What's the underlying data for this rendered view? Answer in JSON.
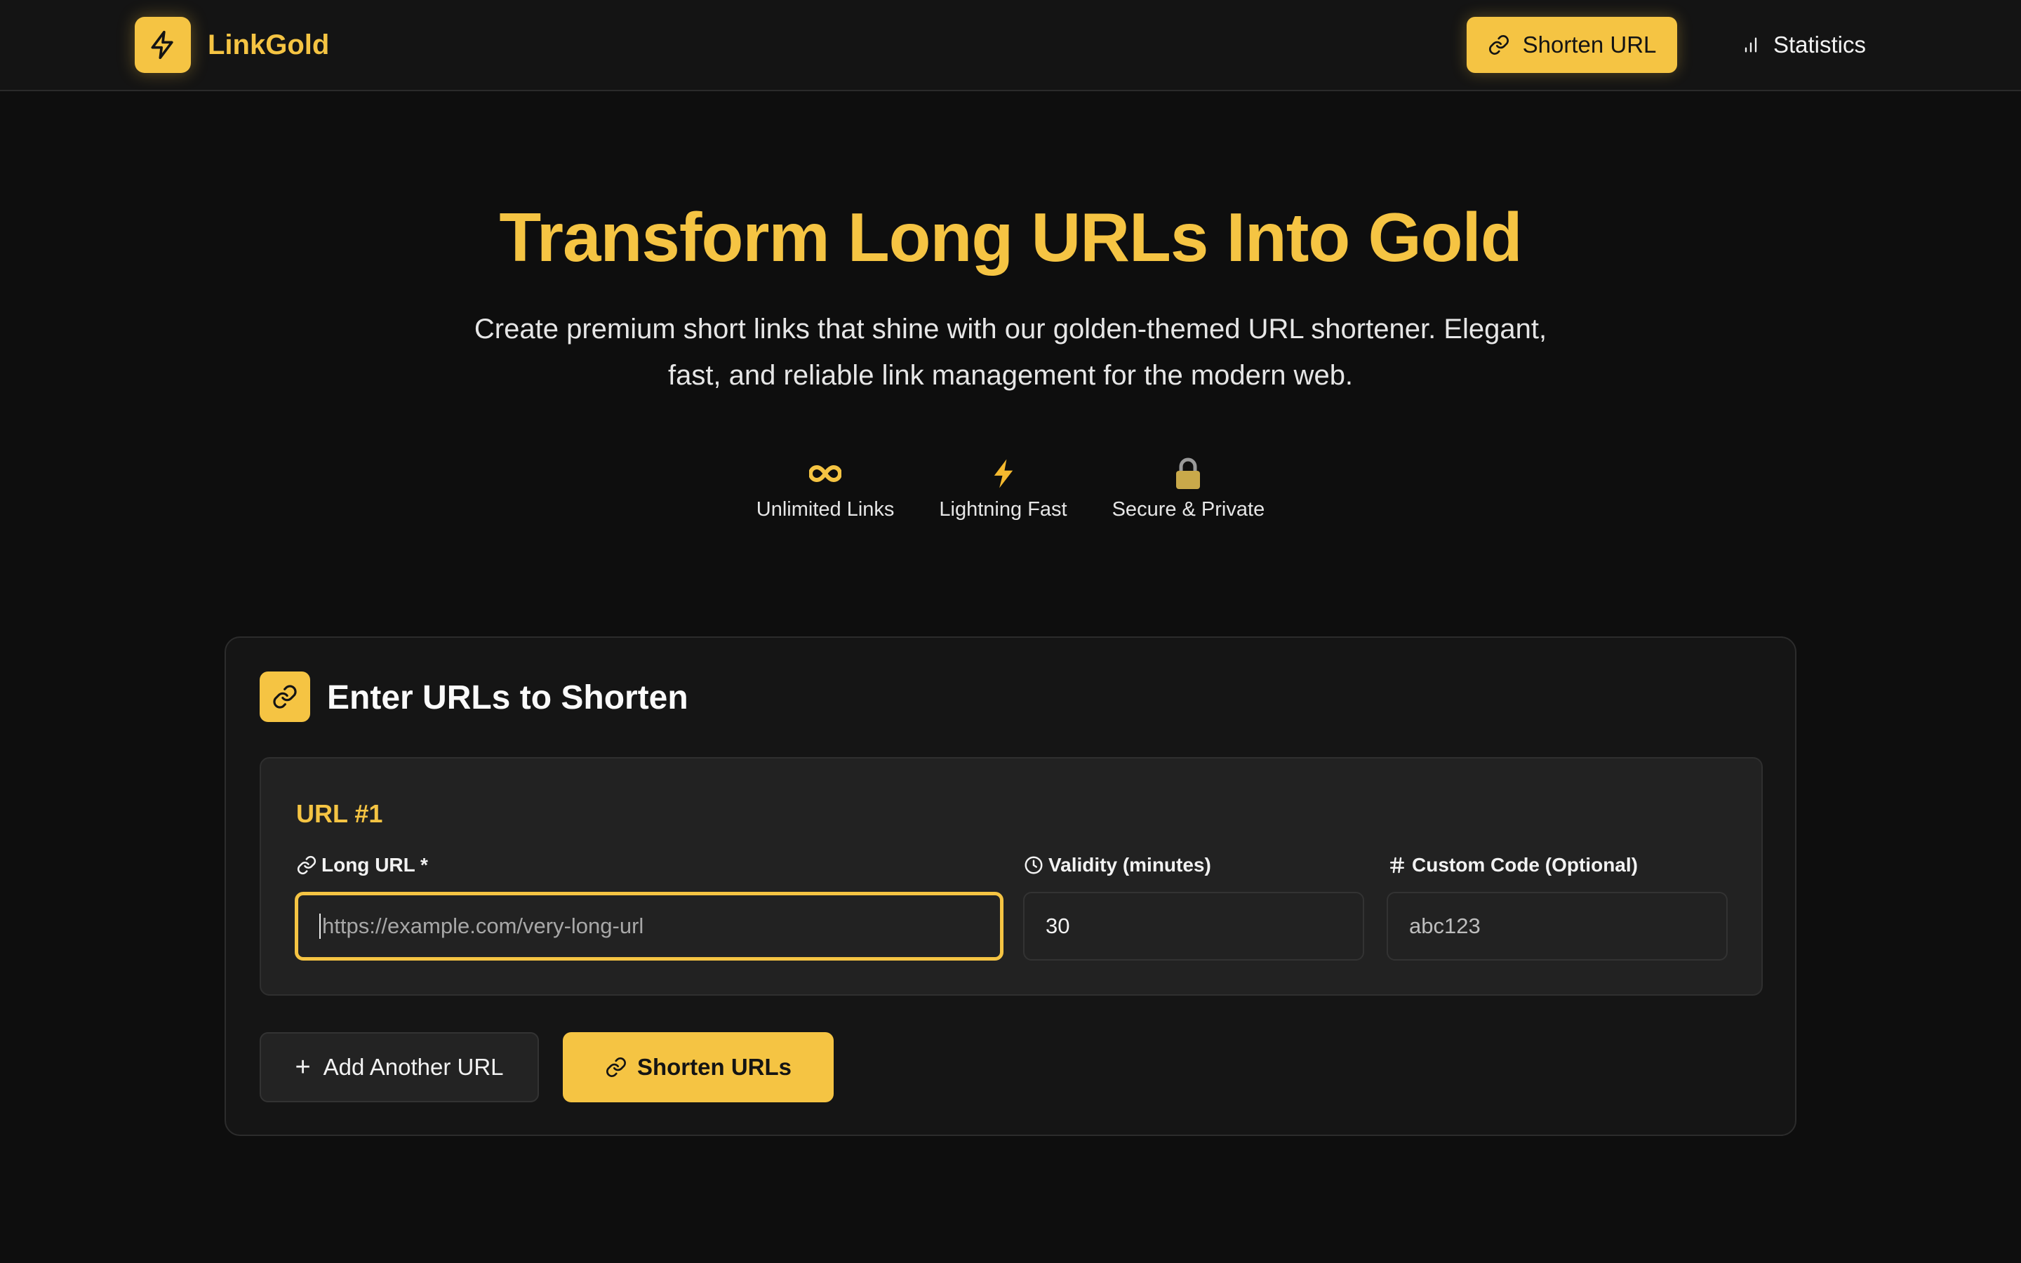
{
  "app": {
    "name": "LinkGold"
  },
  "nav": {
    "shorten_label": "Shorten URL",
    "stats_label": "Statistics"
  },
  "hero": {
    "title": "Transform Long URLs Into Gold",
    "subtitle": "Create premium short links that shine with our golden-themed URL shortener. Elegant, fast, and reliable link management for the modern web."
  },
  "features": [
    {
      "icon": "infinity-icon",
      "glyph": "∞",
      "label": "Unlimited Links"
    },
    {
      "icon": "lightning-icon",
      "glyph": "⚡",
      "label": "Lightning Fast"
    },
    {
      "icon": "lock-icon",
      "glyph": "🔒",
      "label": "Secure & Private"
    }
  ],
  "form": {
    "title": "Enter URLs to Shorten",
    "entries": [
      {
        "heading": "URL #1",
        "long_url_label": "Long URL *",
        "long_url_placeholder": "https://example.com/very-long-url",
        "validity_label": "Validity (minutes)",
        "validity_value": "30",
        "code_label": "Custom Code (Optional)",
        "code_placeholder": "abc123"
      }
    ],
    "add_label": "Add Another URL",
    "submit_label": "Shorten URLs"
  },
  "colors": {
    "accent": "#f5c443",
    "background": "#0e0e0e",
    "panel": "#151515"
  }
}
